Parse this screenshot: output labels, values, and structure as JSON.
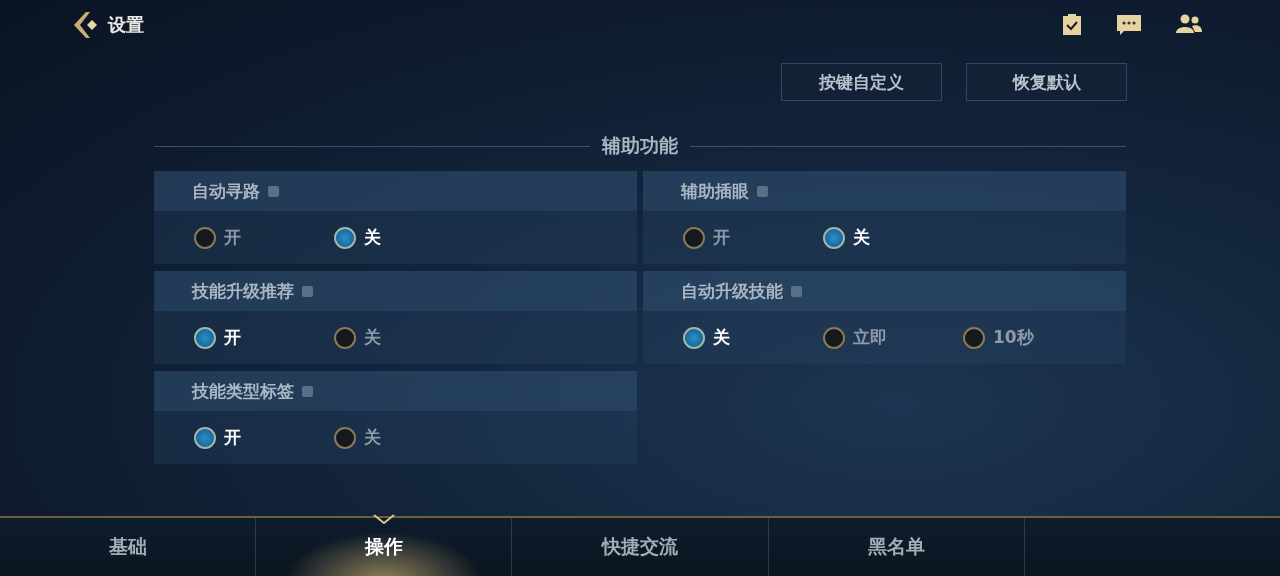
{
  "header": {
    "title": "设置"
  },
  "actions": [
    "按键自定义",
    "恢复默认"
  ],
  "section": {
    "title": "辅助功能"
  },
  "settings": [
    {
      "label": "自动寻路",
      "options": [
        {
          "label": "开",
          "selected": false
        },
        {
          "label": "关",
          "selected": true
        }
      ]
    },
    {
      "label": "辅助插眼",
      "options": [
        {
          "label": "开",
          "selected": false
        },
        {
          "label": "关",
          "selected": true
        }
      ]
    },
    {
      "label": "技能升级推荐",
      "options": [
        {
          "label": "开",
          "selected": true
        },
        {
          "label": "关",
          "selected": false
        }
      ]
    },
    {
      "label": "自动升级技能",
      "options": [
        {
          "label": "关",
          "selected": true
        },
        {
          "label": "立即",
          "selected": false
        },
        {
          "label": "10秒",
          "selected": false
        }
      ]
    },
    {
      "label": "技能类型标签",
      "options": [
        {
          "label": "开",
          "selected": true
        },
        {
          "label": "关",
          "selected": false
        }
      ]
    }
  ],
  "tabs": [
    {
      "label": "基础",
      "selected": false
    },
    {
      "label": "操作",
      "selected": true
    },
    {
      "label": "快捷交流",
      "selected": false
    },
    {
      "label": "黑名单",
      "selected": false
    }
  ]
}
